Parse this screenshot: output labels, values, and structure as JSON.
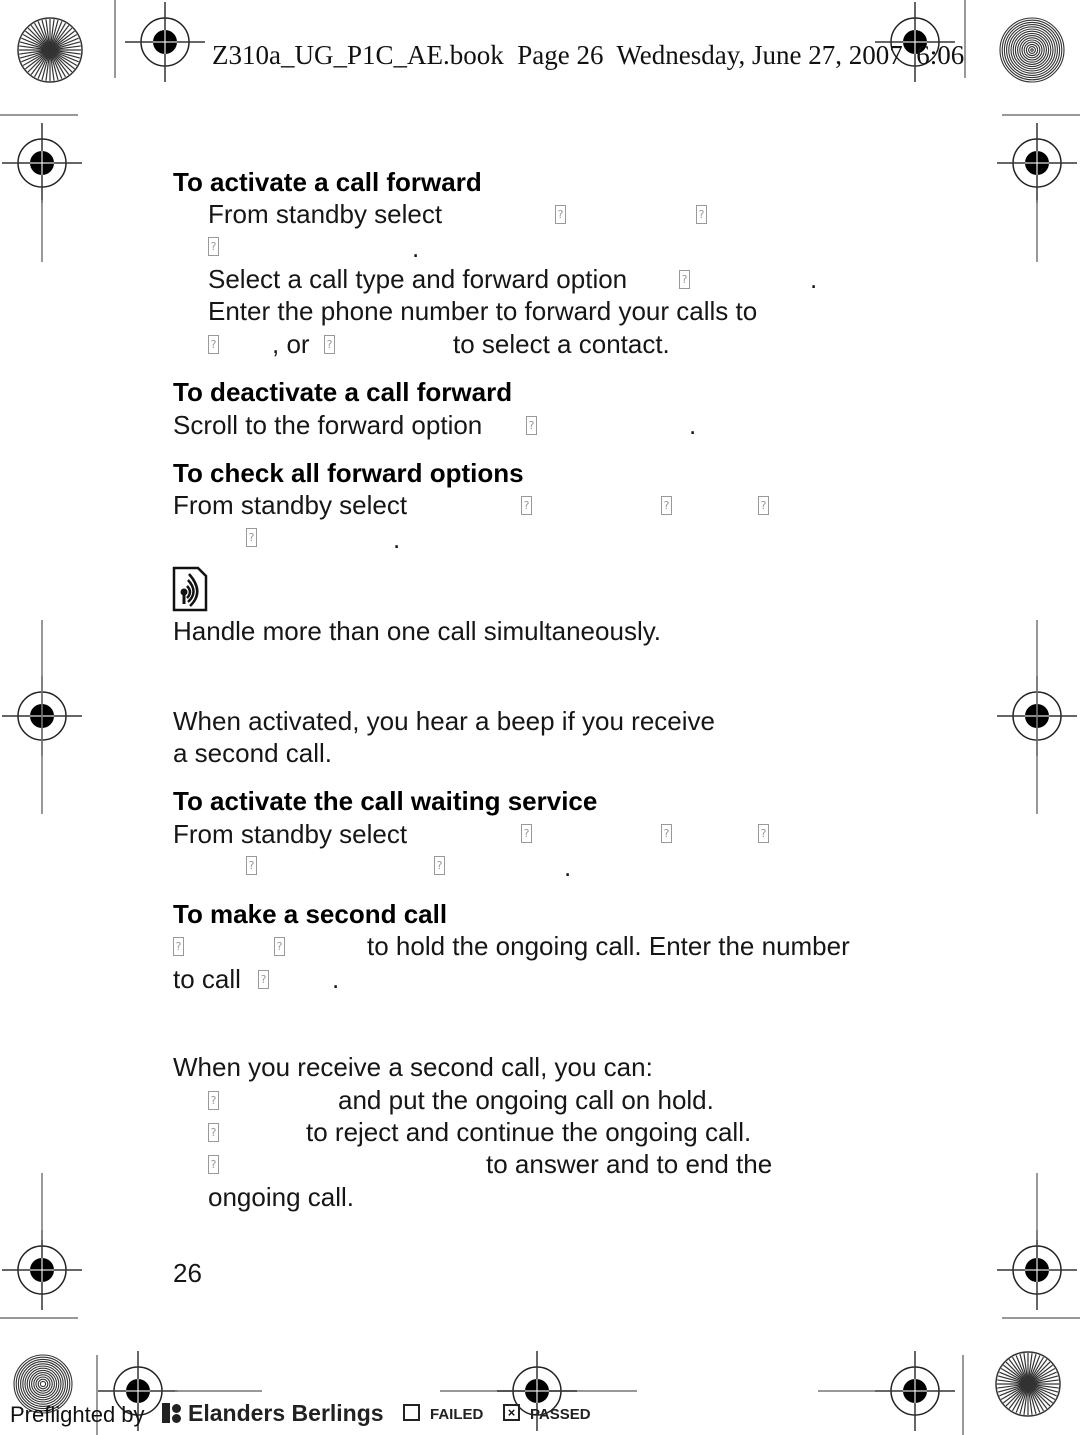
{
  "header": {
    "book_info": "Z310a_UG_P1C_AE.book  Page 26  Wednesday, June 27, 2007  6:06"
  },
  "sections": [
    {
      "heading": "To activate a call forward",
      "lines": [
        "From standby select",
        ".",
        "Select a call type and forward option",
        ".",
        "Enter the phone number to forward your calls to",
        ", or",
        "to select a contact."
      ]
    },
    {
      "heading": "To deactivate a call forward",
      "lines": [
        "Scroll to the forward option",
        "."
      ]
    },
    {
      "heading": "To check all forward options",
      "lines": [
        "From standby select",
        "."
      ]
    },
    {
      "icon": "network-service-icon",
      "lines": [
        "Handle more than one call simultaneously."
      ]
    },
    {
      "lines": [
        "When activated, you hear a beep if you receive",
        "a second call."
      ]
    },
    {
      "heading": "To activate the call waiting service",
      "lines": [
        "From standby select",
        "."
      ]
    },
    {
      "heading": "To make a second call",
      "lines": [
        "to hold the ongoing call. Enter the number",
        "to call",
        "."
      ]
    },
    {
      "lines": [
        "When you receive a second call, you can:",
        "and put the ongoing call on hold.",
        "to reject and continue the ongoing call.",
        "to answer and to end the",
        "ongoing call."
      ]
    }
  ],
  "page_number": "26",
  "footer": {
    "preflighted": "Preflighted by",
    "brand": "Elanders Berlings",
    "failed_label": "FAILED",
    "passed_label": "PASSED",
    "failed_checked": false,
    "passed_checked": true,
    "check_mark": "×",
    "placeholder_glyph": "?"
  }
}
